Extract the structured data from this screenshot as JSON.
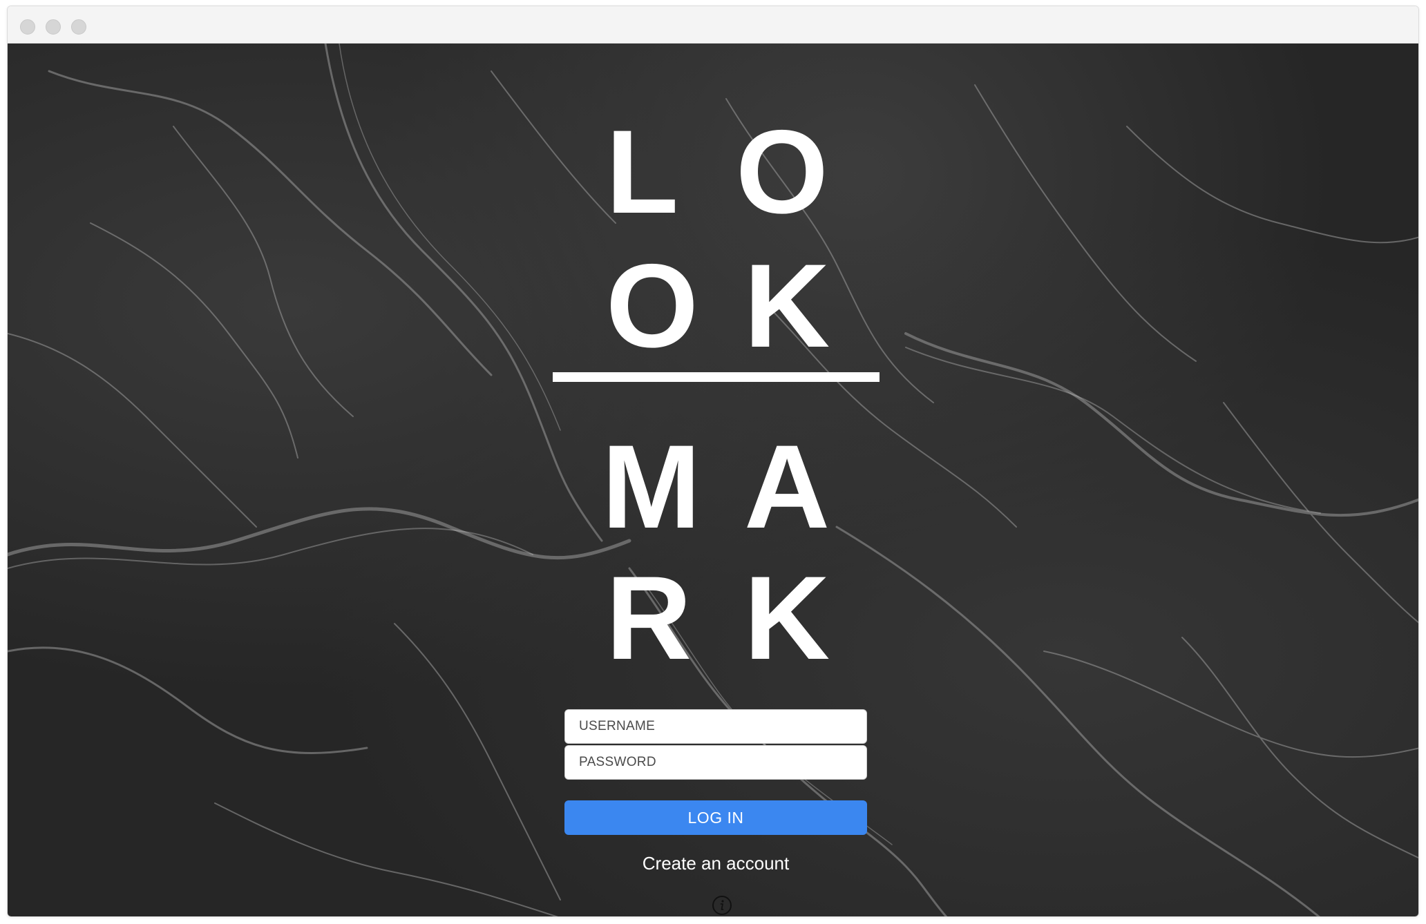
{
  "window": {
    "traffic_lights": [
      "close",
      "minimize",
      "zoom"
    ]
  },
  "logo": {
    "letters": [
      "L",
      "O",
      "O",
      "K",
      "M",
      "A",
      "R",
      "K"
    ],
    "brand": "LOOKMARK"
  },
  "login": {
    "username_placeholder": "USERNAME",
    "password_placeholder": "PASSWORD",
    "submit_label": "LOG IN",
    "create_account_label": "Create an account"
  },
  "footer": {
    "info_icon": "info-icon"
  },
  "colors": {
    "background": "#262626",
    "accent": "#3b87f0",
    "logo": "#ffffff"
  }
}
